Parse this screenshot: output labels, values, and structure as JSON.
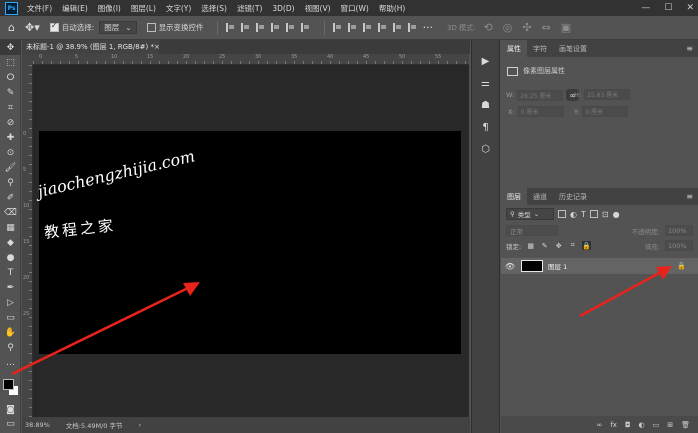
{
  "app": {
    "logo": "Ps"
  },
  "menu": [
    "文件(F)",
    "编辑(E)",
    "图像(I)",
    "图层(L)",
    "文字(Y)",
    "选择(S)",
    "滤镜(T)",
    "3D(D)",
    "视图(V)",
    "窗口(W)",
    "帮助(H)"
  ],
  "window_controls": {
    "minimize": "—",
    "maximize": "☐",
    "close": "✕"
  },
  "options": {
    "auto_select_label": "自动选择:",
    "auto_select_value": "图层",
    "show_transform_label": "显示变换控件",
    "mode3d_label": "3D 模式:"
  },
  "document": {
    "tab_title": "未标题-1 @ 38.9% (图层 1, RGB/8#) *",
    "close": "×"
  },
  "ruler": {
    "h_ticks": [
      "0",
      "5",
      "10",
      "15",
      "20",
      "25",
      "30",
      "35",
      "40",
      "45",
      "50",
      "55"
    ],
    "v_ticks": [
      "0",
      "5",
      "10",
      "15",
      "20",
      "25"
    ]
  },
  "status": {
    "zoom": "38.89%",
    "doc_info": "文档:5.49M/0 字节",
    "arrow": "›"
  },
  "watermark": {
    "line1": "jiaochengzhijia.com",
    "line2": "教程之家"
  },
  "tools": [
    "✥",
    "⬚",
    "ⵔ",
    "✎",
    "⌗",
    "⊘",
    "✚",
    "⊙",
    "🖌",
    "⚲",
    "✐",
    "⌫",
    "▦",
    "◆",
    "●",
    "T",
    "✒",
    "▷",
    "▭",
    "✋",
    "⚲",
    "…"
  ],
  "colors": {
    "foreground": "#000000",
    "background": "#ffffff",
    "arrow": "#e8231c",
    "canvas": "#000000"
  },
  "right_strip_icons": [
    "▶",
    "⚌",
    "☗",
    "¶",
    "⬡"
  ],
  "properties_panel": {
    "tabs": [
      "属性",
      "字符",
      "画笔设置"
    ],
    "section_title": "像素图层属性",
    "w_label": "W:",
    "w_value": "26.25 厘米",
    "h_label": "H:",
    "h_value": "15.83 厘米",
    "x_label": "X:",
    "x_value": "0 厘米",
    "y_label": "Y:",
    "y_value": "0 厘米",
    "link": "∞"
  },
  "layers_panel": {
    "tabs": [
      "图层",
      "通道",
      "历史记录"
    ],
    "kind_label": "类型",
    "blend_mode": "正常",
    "opacity_label": "不透明度:",
    "opacity_value": "100%",
    "lock_label": "锁定:",
    "fill_label": "填充:",
    "fill_value": "100%",
    "layer_name": "图层 1",
    "bottom_icons": [
      "∞",
      "fx",
      "◘",
      "◐",
      "▭",
      "⊞",
      "🗑"
    ]
  },
  "panel_menu": "≡"
}
